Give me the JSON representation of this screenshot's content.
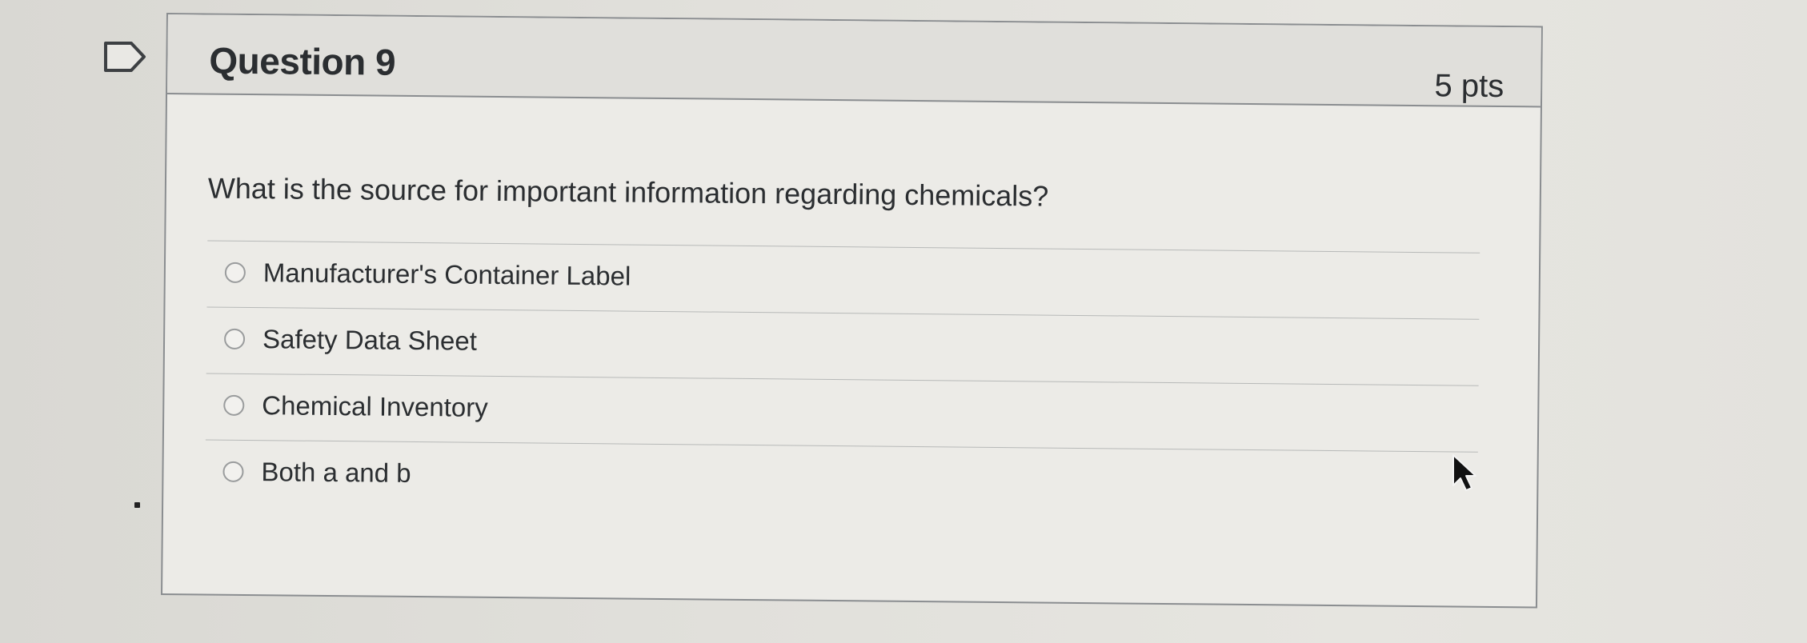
{
  "question": {
    "title": "Question 9",
    "points": "5 pts",
    "prompt": "What is the source for important information regarding chemicals?"
  },
  "answers": [
    {
      "label": "Manufacturer's Container Label",
      "selected": false
    },
    {
      "label": "Safety Data Sheet",
      "selected": false
    },
    {
      "label": "Chemical Inventory",
      "selected": false
    },
    {
      "label": "Both a and b",
      "selected": false
    }
  ],
  "icons": {
    "flag": "flag-outline-icon",
    "cursor": "mouse-pointer-icon",
    "radio": "radio-button-icon"
  },
  "colors": {
    "text": "#2b2e31",
    "border": "#8a8d90",
    "header_bg": "#e0dfdb"
  }
}
